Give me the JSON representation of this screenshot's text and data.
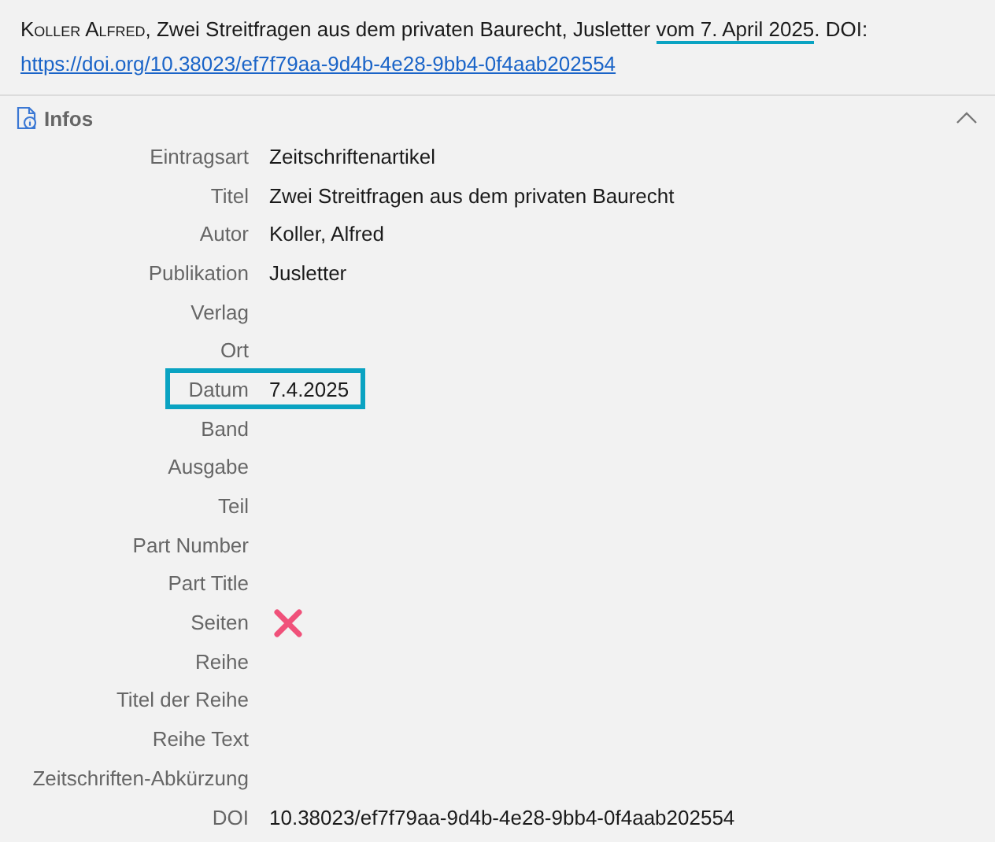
{
  "citation": {
    "author": "Koller Alfred",
    "text_before": ", Zwei Streitfragen aus dem privaten Baurecht, Jusletter ",
    "underlined": "vom 7. April 2025",
    "text_after": ". DOI:",
    "link": "https://doi.org/10.38023/ef7f79aa-9d4b-4e28-9bb4-0f4aab202554"
  },
  "section": {
    "title": "Infos",
    "expanded": true
  },
  "fields": [
    {
      "label": "Eintragsart",
      "value": "Zeitschriftenartikel",
      "highlighted": false,
      "marked": false
    },
    {
      "label": "Titel",
      "value": "Zwei Streitfragen aus dem privaten Baurecht",
      "highlighted": false,
      "marked": false
    },
    {
      "label": "Autor",
      "value": "Koller, Alfred",
      "highlighted": false,
      "marked": false
    },
    {
      "label": "Publikation",
      "value": "Jusletter",
      "highlighted": false,
      "marked": false
    },
    {
      "label": "Verlag",
      "highlighted": false,
      "marked": false
    },
    {
      "label": "Ort",
      "highlighted": false,
      "marked": false
    },
    {
      "label": "Datum",
      "value": "7.4.2025",
      "highlighted": true,
      "marked": false
    },
    {
      "label": "Band",
      "highlighted": false,
      "marked": false
    },
    {
      "label": "Ausgabe",
      "highlighted": false,
      "marked": false
    },
    {
      "label": "Teil",
      "highlighted": false,
      "marked": false
    },
    {
      "label": "Part Number",
      "highlighted": false,
      "marked": false
    },
    {
      "label": "Part Title",
      "highlighted": false,
      "marked": false
    },
    {
      "label": "Seiten",
      "highlighted": false,
      "marked": true
    },
    {
      "label": "Reihe",
      "highlighted": false,
      "marked": false
    },
    {
      "label": "Titel der Reihe",
      "highlighted": false,
      "marked": false
    },
    {
      "label": "Reihe Text",
      "highlighted": false,
      "marked": false
    },
    {
      "label": "Zeitschriften-Abkürzung",
      "highlighted": false,
      "marked": false
    },
    {
      "label": "DOI",
      "value": "10.38023/ef7f79aa-9d4b-4e28-9bb4-0f4aab202554",
      "highlighted": false,
      "marked": false
    }
  ]
}
